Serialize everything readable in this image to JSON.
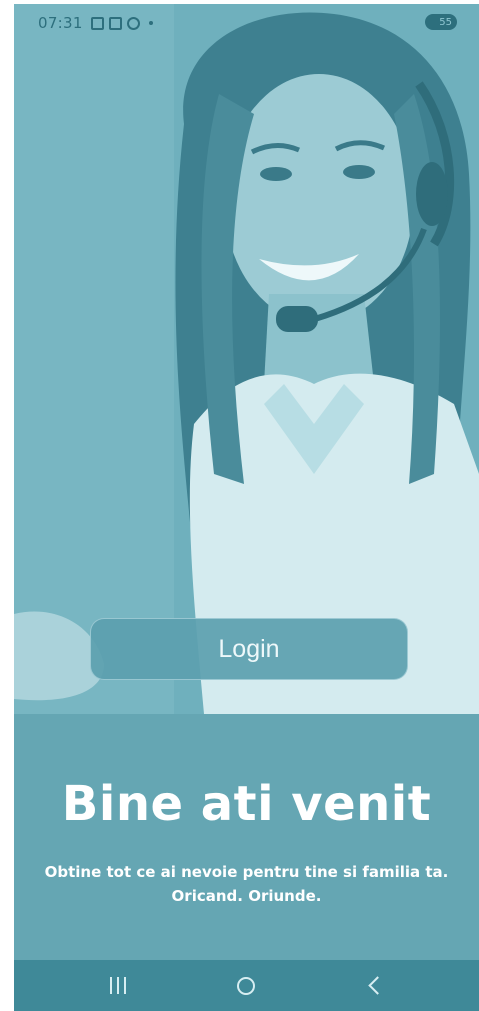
{
  "status_bar": {
    "time": "07:31",
    "icons": [
      "calendar-icon",
      "gallery-icon",
      "alarm-icon",
      "dot-icon"
    ],
    "battery_label": "55"
  },
  "hero": {
    "image": "support-agent-photo"
  },
  "login": {
    "label": "Login"
  },
  "welcome": {
    "title": "Bine ati venit",
    "subtitle_line1": "Obtine tot ce ai nevoie pentru tine si familia ta.",
    "subtitle_line2": "Oricand. Oriunde."
  },
  "nav_bar": {
    "buttons": [
      "recents-icon",
      "home-icon",
      "back-icon"
    ]
  },
  "colors": {
    "background": "#65a6b3",
    "hero_tint": "#6fb0bd",
    "nav_bar": "#3f8998",
    "text": "#ffffff"
  }
}
